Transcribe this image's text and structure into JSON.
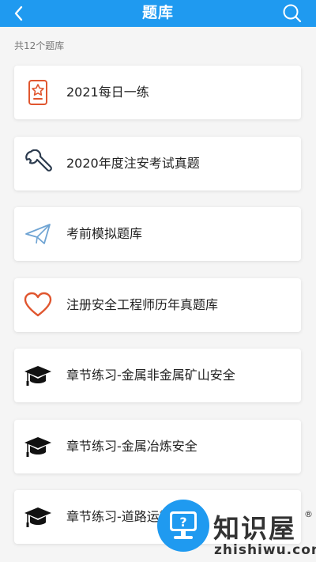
{
  "header": {
    "title": "题库",
    "back_icon": "chevron-left-icon",
    "search_icon": "search-icon",
    "background_color": "#1f9af0"
  },
  "count_label": "共12个题库",
  "items": [
    {
      "label": "2021每日一练",
      "icon": "badge-star-icon",
      "icon_color": "#e0562f"
    },
    {
      "label": "2020年度注安考试真题",
      "icon": "wrench-icon",
      "icon_color": "#2b3a4d"
    },
    {
      "label": "考前模拟题库",
      "icon": "paper-plane-icon",
      "icon_color": "#6fa4d3"
    },
    {
      "label": "注册安全工程师历年真题库",
      "icon": "heart-icon",
      "icon_color": "#e0562f"
    },
    {
      "label": "章节练习-金属非金属矿山安全",
      "icon": "graduation-cap-icon",
      "icon_color": "#111111"
    },
    {
      "label": "章节练习-金属冶炼安全",
      "icon": "graduation-cap-icon",
      "icon_color": "#111111"
    },
    {
      "label": "章节练习-道路运输安全",
      "icon": "graduation-cap-icon",
      "icon_color": "#111111"
    }
  ],
  "watermark": {
    "title": "知识屋",
    "subtitle": "zhishiwu.com",
    "registered": "®",
    "color": "#1f9af0"
  }
}
